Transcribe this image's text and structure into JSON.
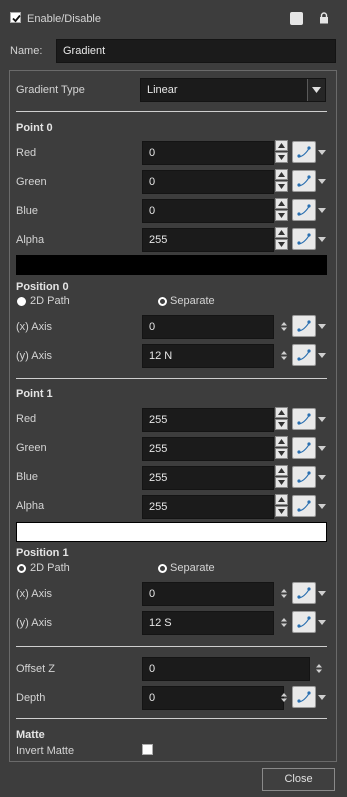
{
  "header": {
    "enable_label": "Enable/Disable",
    "enabled": true,
    "name_label": "Name:",
    "name_value": "Gradient"
  },
  "gradient_type": {
    "label": "Gradient Type",
    "value": "Linear"
  },
  "point0": {
    "title": "Point 0",
    "red_label": "Red",
    "red": "0",
    "green_label": "Green",
    "green": "0",
    "blue_label": "Blue",
    "blue": "0",
    "alpha_label": "Alpha",
    "alpha": "255",
    "swatch_color": "#000000"
  },
  "position0": {
    "title": "Position 0",
    "path_label": "2D Path",
    "separate_label": "Separate",
    "selected": "2D Path",
    "x_label": "(x) Axis",
    "x": "0",
    "y_label": "(y) Axis",
    "y": "12 N"
  },
  "point1": {
    "title": "Point 1",
    "red_label": "Red",
    "red": "255",
    "green_label": "Green",
    "green": "255",
    "blue_label": "Blue",
    "blue": "255",
    "alpha_label": "Alpha",
    "alpha": "255",
    "swatch_color": "#ffffff"
  },
  "position1": {
    "title": "Position 1",
    "path_label": "2D Path",
    "separate_label": "Separate",
    "selected": "Separate",
    "x_label": "(x) Axis",
    "x": "0",
    "y_label": "(y) Axis",
    "y": "12 S"
  },
  "offset": {
    "offset_z_label": "Offset Z",
    "offset_z": "0",
    "depth_label": "Depth",
    "depth": "0"
  },
  "matte": {
    "title": "Matte",
    "invert_label": "Invert Matte",
    "invert": false
  },
  "footer": {
    "close_label": "Close"
  },
  "icons": {
    "lock": "lock-icon",
    "color_square": "color-square-icon",
    "function_curve": "function-curve-icon"
  },
  "colors": {
    "background": "#3d3d3d",
    "field": "#1b1b1b",
    "curve_accent": "#2a6fb0"
  }
}
